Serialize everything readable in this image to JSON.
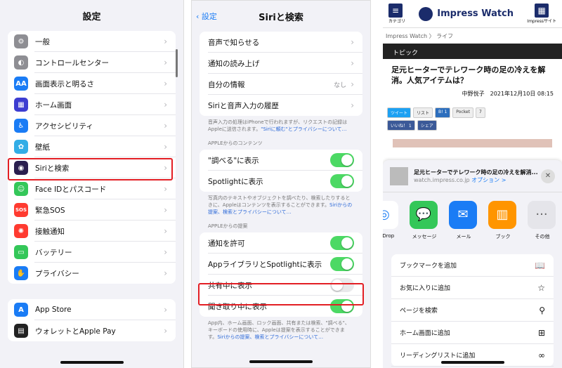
{
  "settings": {
    "title": "設定",
    "items": [
      {
        "label": "一般",
        "icon": "gear-icon",
        "color": "#8e8e93",
        "glyph": "⚙"
      },
      {
        "label": "コントロールセンター",
        "icon": "toggles-icon",
        "color": "#8e8e93",
        "glyph": "◐"
      },
      {
        "label": "画面表示と明るさ",
        "icon": "aa-icon",
        "color": "#1a7cf5",
        "glyph": "AA"
      },
      {
        "label": "ホーム画面",
        "icon": "home-screen-icon",
        "color": "#3d3dd1",
        "glyph": "▦"
      },
      {
        "label": "アクセシビリティ",
        "icon": "accessibility-icon",
        "color": "#1a7cf5",
        "glyph": "♿"
      },
      {
        "label": "壁紙",
        "icon": "wallpaper-icon",
        "color": "#32ade6",
        "glyph": "✿"
      },
      {
        "label": "Siriと検索",
        "icon": "siri-icon",
        "color": "#2a1f4f",
        "glyph": "◉"
      },
      {
        "label": "Face IDとパスコード",
        "icon": "face-id-icon",
        "color": "#34c759",
        "glyph": "☺"
      },
      {
        "label": "緊急SOS",
        "icon": "sos-icon",
        "color": "#ff3b30",
        "glyph": "SOS"
      },
      {
        "label": "接触通知",
        "icon": "exposure-icon",
        "color": "#ff3b30",
        "glyph": "✺"
      },
      {
        "label": "バッテリー",
        "icon": "battery-icon",
        "color": "#34c759",
        "glyph": "▭"
      },
      {
        "label": "プライバシー",
        "icon": "hand-icon",
        "color": "#1a7cf5",
        "glyph": "✋"
      }
    ],
    "items2": [
      {
        "label": "App Store",
        "icon": "app-store-icon",
        "color": "#1a7cf5",
        "glyph": "A"
      },
      {
        "label": "ウォレットとApple Pay",
        "icon": "wallet-icon",
        "color": "#222",
        "glyph": "▤"
      }
    ]
  },
  "siri": {
    "back": "設定",
    "title": "Siriと検索",
    "top": [
      {
        "label": "音声で知らせる"
      },
      {
        "label": "通知の読み上げ"
      },
      {
        "label": "自分の情報",
        "value": "なし"
      },
      {
        "label": "Siriと音声入力の履歴"
      }
    ],
    "foot1": "音声入力の処理はiPhoneで行われますが、リクエストの記録はAppleに送信されます。",
    "foot1_link": "\"Siriに頼む\"とプライバシーについて…",
    "sec1": "APPLEからのコンテンツ",
    "content": [
      {
        "label": "\"調べる\"に表示",
        "on": true
      },
      {
        "label": "Spotlightに表示",
        "on": true
      }
    ],
    "foot2": "写真内のテキストやオブジェクトを調べたり、検索したりするときに、Appleはコンテンツを表示することができます。",
    "foot2_link": "Siriからの提案、検索とプライバシーについて…",
    "sec2": "APPLEからの提案",
    "suggest": [
      {
        "label": "通知を許可",
        "on": true
      },
      {
        "label": "AppライブラリとSpotlightに表示",
        "on": true
      },
      {
        "label": "共有中に表示",
        "on": false
      },
      {
        "label": "聞き取り中に表示",
        "on": true
      }
    ],
    "foot3": "App内、ホーム画面、ロック画面、共有または検索、\"調べる\"、キーボードの使用時に、Appleは提案を表示することができます。",
    "foot3_link": "Siriからの提案、検索とプライバシーについて…"
  },
  "share": {
    "category": "カテゴリ",
    "logo": "Impress Watch",
    "site": "Impressサイト",
    "crumb1": "Impress Watch",
    "crumb2": "ライフ",
    "topic": "トピック",
    "headline": "足元ヒーターでテレワーク時の足の冷えを解消。人気アイテムは？",
    "byline": "中野悦子　2021年12月10日 08:15",
    "btns": [
      "ツイート",
      "リスト",
      "B! 1",
      "Pocket",
      "7",
      "いいね！ 1",
      "シェア"
    ],
    "sheet_title": "足元ヒーターでテレワーク時の足の冷えを解消...",
    "sheet_url": "watch.impress.co.jp",
    "sheet_opt": "オプション >",
    "apps": [
      {
        "label": "AirDrop",
        "color": "#fff",
        "icon": "airdrop-icon"
      },
      {
        "label": "メッセージ",
        "color": "#34c759",
        "icon": "messages-icon"
      },
      {
        "label": "メール",
        "color": "#1a7cf5",
        "icon": "mail-icon"
      },
      {
        "label": "ブック",
        "color": "#ff9500",
        "icon": "books-icon"
      },
      {
        "label": "その他",
        "color": "#e5e5ea",
        "icon": "more-icon"
      }
    ],
    "actions": [
      {
        "label": "ブックマークを追加",
        "glyph": "📖"
      },
      {
        "label": "お気に入りに追加",
        "glyph": "☆"
      },
      {
        "label": "ページを検索",
        "glyph": "⚲"
      },
      {
        "label": "ホーム画面に追加",
        "glyph": "⊞"
      },
      {
        "label": "リーディングリストに追加",
        "glyph": "∞"
      }
    ]
  }
}
